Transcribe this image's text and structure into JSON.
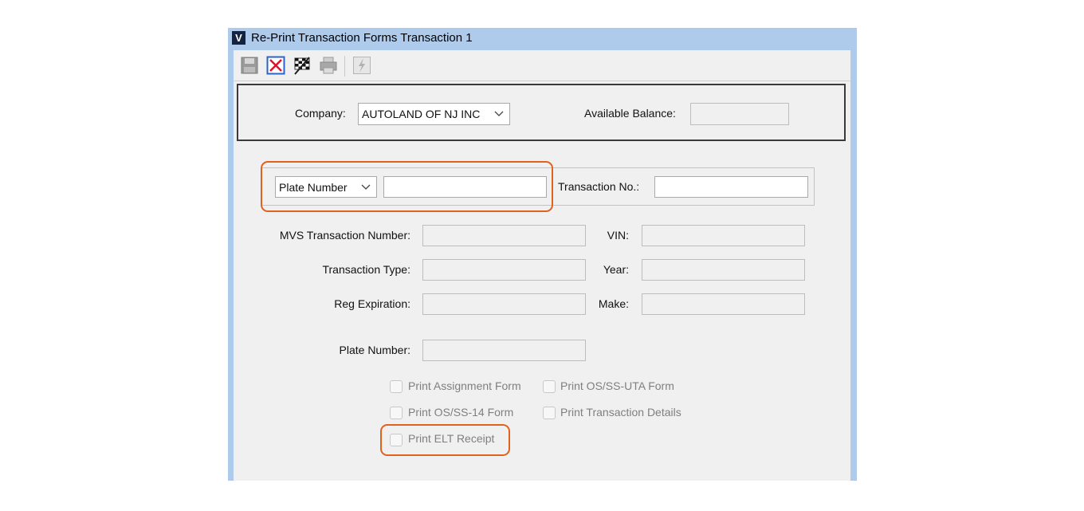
{
  "window": {
    "title": "Re-Print Transaction Forms Transaction 1",
    "app_icon_letter": "V"
  },
  "toolbar": {
    "buttons": [
      {
        "icon": "save-icon",
        "enabled": false
      },
      {
        "icon": "cancel-icon",
        "enabled": true
      },
      {
        "icon": "flag-icon",
        "enabled": true
      },
      {
        "icon": "print-icon",
        "enabled": false
      },
      {
        "icon": "lightning-icon",
        "enabled": false
      }
    ]
  },
  "header": {
    "company_label": "Company:",
    "company_value": "AUTOLAND OF NJ INC",
    "balance_label": "Available Balance:",
    "balance_value": ""
  },
  "search": {
    "type_value": "Plate Number",
    "search_value": "",
    "transaction_no_label": "Transaction No.:",
    "transaction_no_value": ""
  },
  "details": {
    "mvs_label": "MVS Transaction Number:",
    "vin_label": "VIN:",
    "type_label": "Transaction Type:",
    "year_label": "Year:",
    "reg_label": "Reg Expiration:",
    "make_label": "Make:",
    "plate_label": "Plate Number:"
  },
  "options": {
    "assignment": "Print Assignment Form",
    "os_uta": "Print OS/SS-UTA Form",
    "os14": "Print OS/SS-14 Form",
    "details": "Print Transaction Details",
    "elt": "Print ELT Receipt"
  },
  "colors": {
    "highlight": "#e0621f",
    "title_bar": "#aecbeb"
  }
}
